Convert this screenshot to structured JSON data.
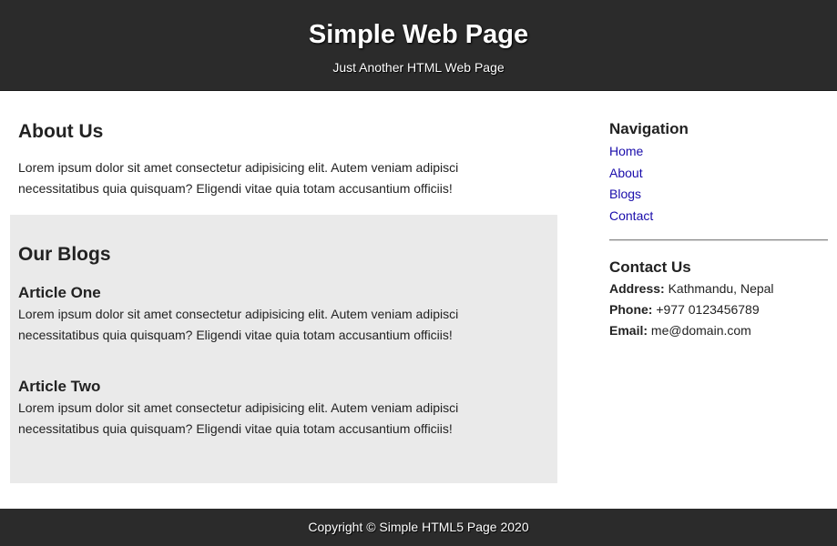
{
  "header": {
    "title": "Simple Web Page",
    "subtitle": "Just Another HTML Web Page"
  },
  "about": {
    "title": "About Us",
    "text": "Lorem ipsum dolor sit amet consectetur adipisicing elit. Autem veniam adipisci necessitatibus quia quisquam? Eligendi vitae quia totam accusantium officiis!"
  },
  "blogs": {
    "title": "Our Blogs",
    "articles": [
      {
        "title": "Article One",
        "text": "Lorem ipsum dolor sit amet consectetur adipisicing elit. Autem veniam adipisci necessitatibus quia quisquam? Eligendi vitae quia totam accusantium officiis!"
      },
      {
        "title": "Article Two",
        "text": "Lorem ipsum dolor sit amet consectetur adipisicing elit. Autem veniam adipisci necessitatibus quia quisquam? Eligendi vitae quia totam accusantium officiis!"
      }
    ]
  },
  "sidebar": {
    "nav_title": "Navigation",
    "nav_items": [
      {
        "label": "Home"
      },
      {
        "label": "About"
      },
      {
        "label": "Blogs"
      },
      {
        "label": "Contact"
      }
    ],
    "contact_title": "Contact Us",
    "contact": {
      "address_label": "Address:",
      "address_value": "Kathmandu, Nepal",
      "phone_label": "Phone:",
      "phone_value": "+977 0123456789",
      "email_label": "Email:",
      "email_value": "me@domain.com"
    }
  },
  "footer": {
    "text": "Copyright © Simple HTML5 Page 2020"
  },
  "colors": {
    "header_bg": "#2b2b2b",
    "blogs_bg": "#eaeaea",
    "link": "#1a0dab",
    "text": "#222222"
  }
}
